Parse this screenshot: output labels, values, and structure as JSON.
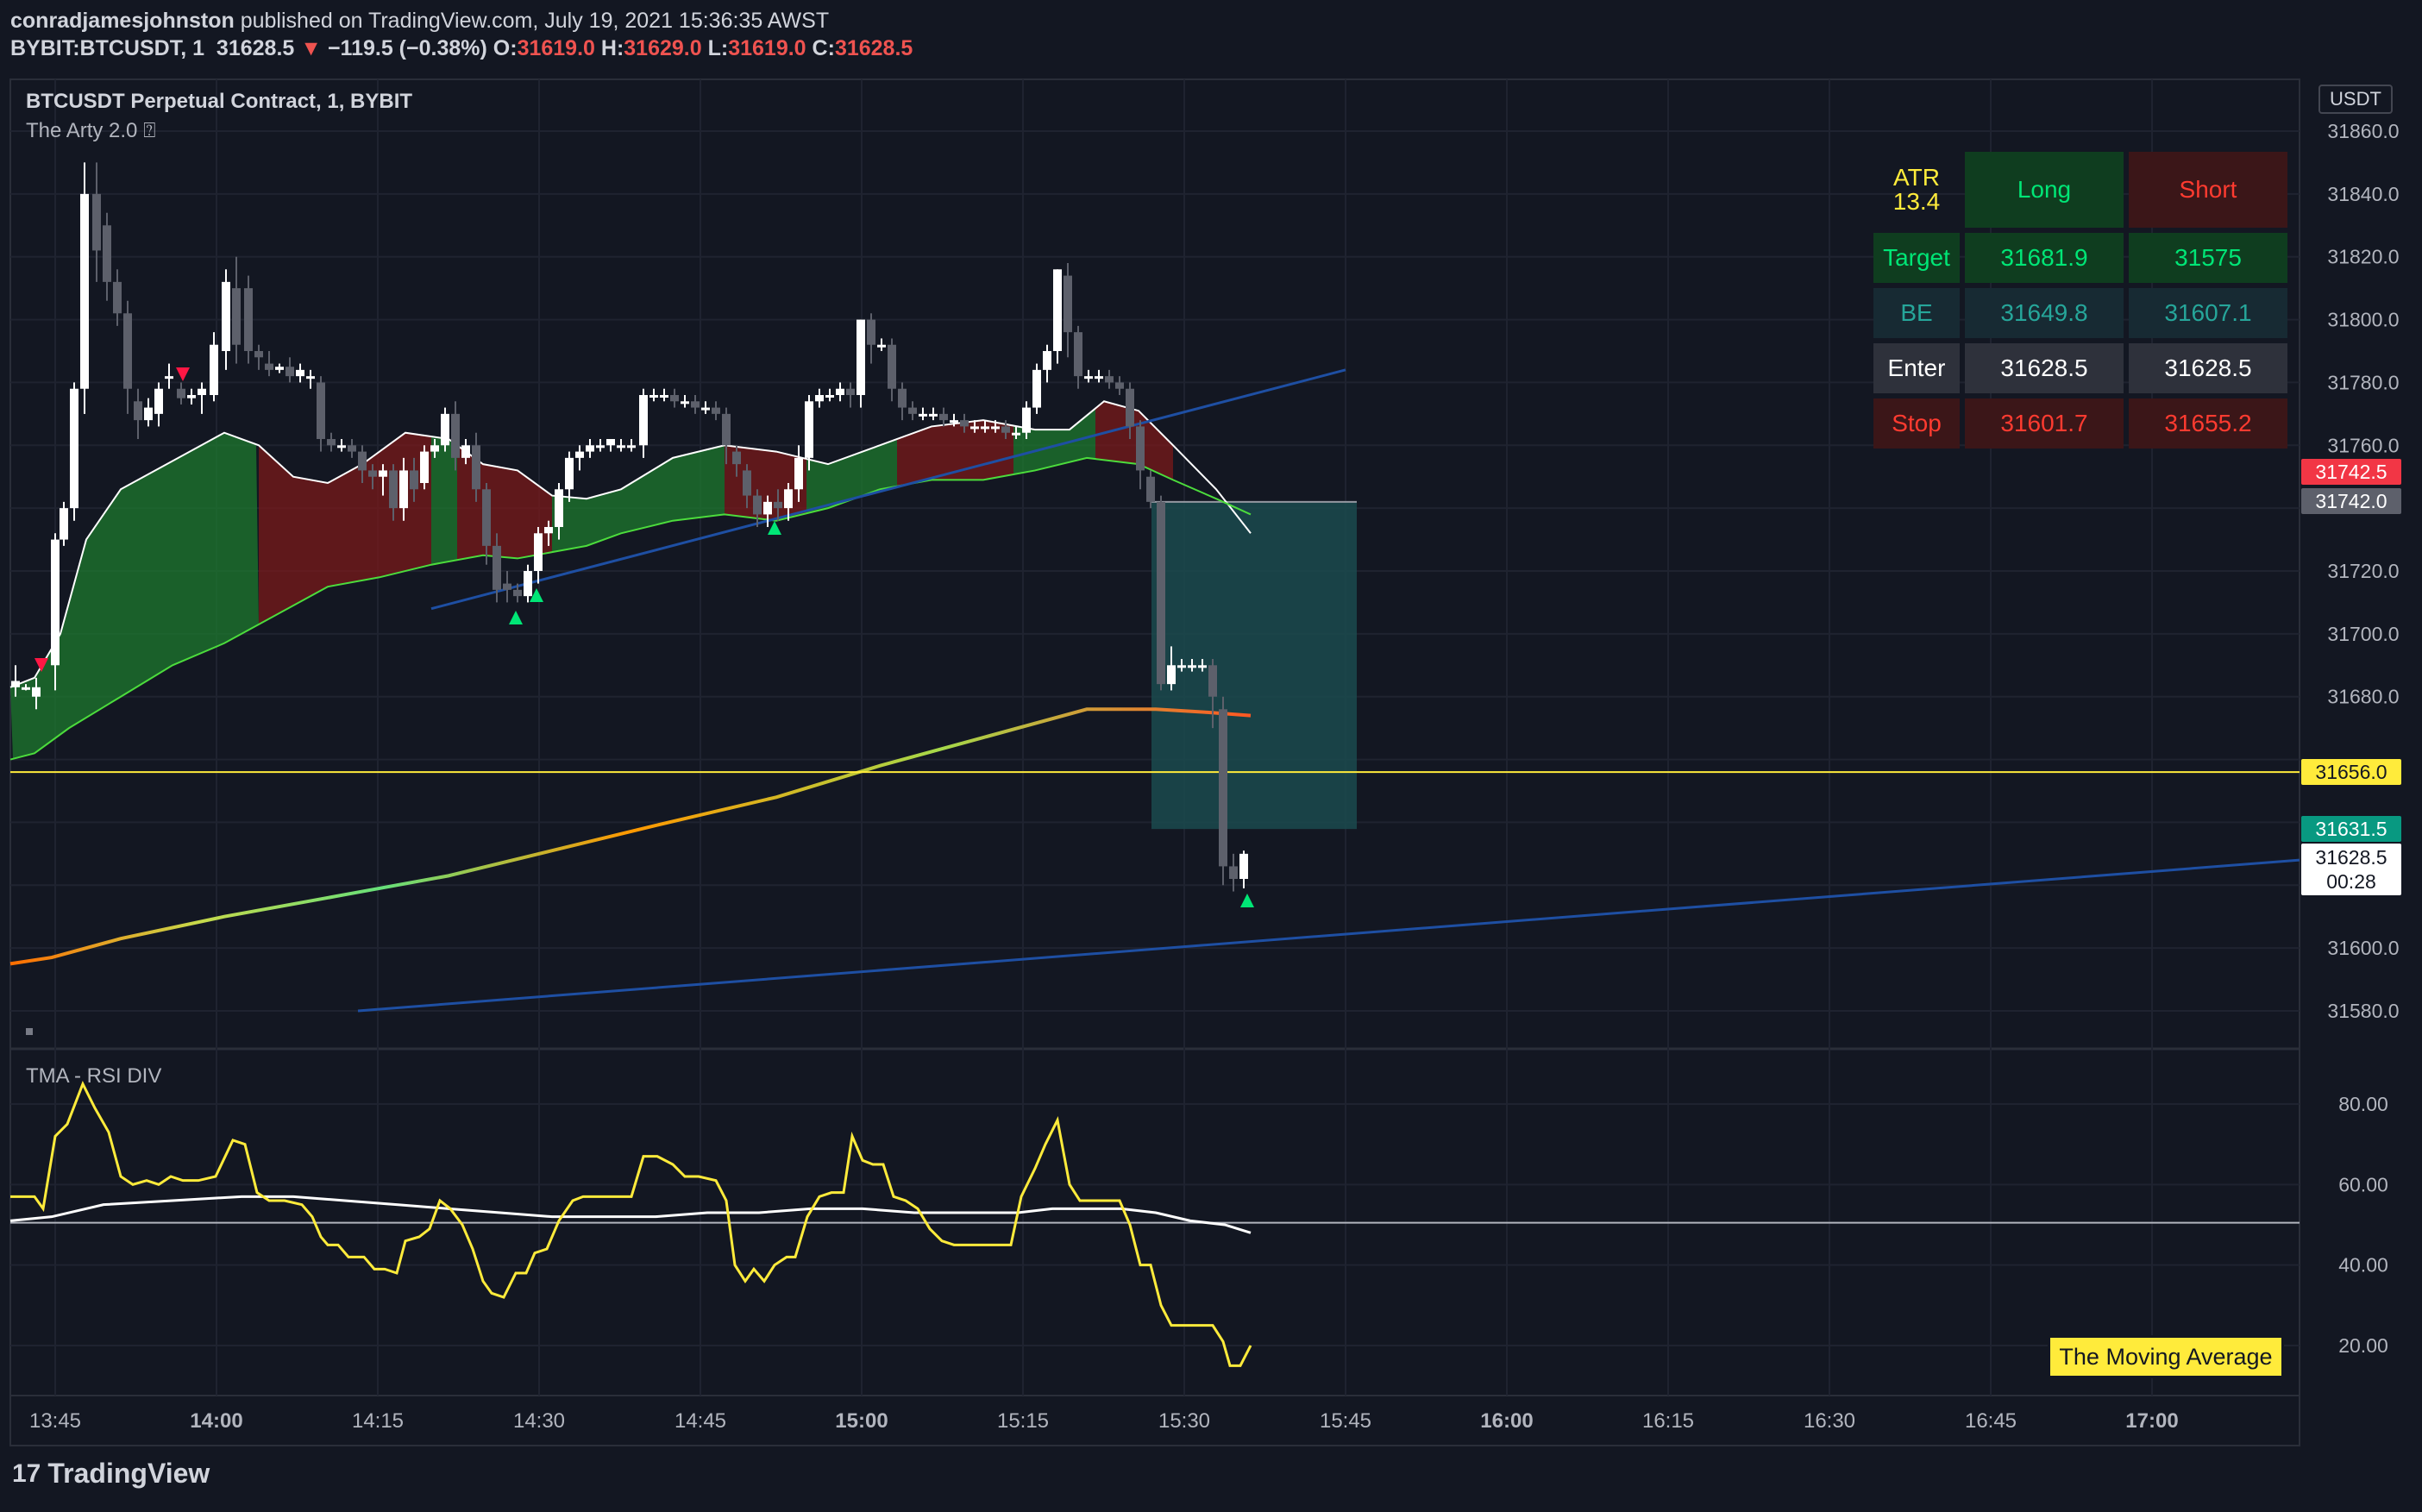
{
  "header": {
    "publisher": "conradjamesjohnston",
    "published_text": "published on TradingView.com, July 19, 2021 15:36:35 AWST",
    "symbol": "BYBIT:BTCUSDT, 1",
    "last": "31628.5",
    "down_arrow": "▼",
    "change": "−119.5 (−0.38%)",
    "o_label": "O:",
    "o_val": "31619.0",
    "h_label": "H:",
    "h_val": "31629.0",
    "l_label": "L:",
    "l_val": "31619.0",
    "c_label": "C:",
    "c_val": "31628.5"
  },
  "legend": {
    "title": "BTCUSDT Perpetual Contract, 1, BYBIT",
    "indicator": "The Arty 2.0 ⍰"
  },
  "oscillator": {
    "title": "TMA - RSI DIV"
  },
  "currency_button": "USDT",
  "info_table": {
    "atr_label": "ATR",
    "atr_value": "13.4",
    "long_header": "Long",
    "short_header": "Short",
    "rows": [
      {
        "label": "Target",
        "long": "31681.9",
        "short": "31575"
      },
      {
        "label": "BE",
        "long": "31649.8",
        "short": "31607.1"
      },
      {
        "label": "Enter",
        "long": "31628.5",
        "short": "31628.5"
      },
      {
        "label": "Stop",
        "long": "31601.7",
        "short": "31655.2"
      }
    ]
  },
  "price_axis": {
    "labels": [
      "31860.0",
      "31840.0",
      "31820.0",
      "31800.0",
      "31780.0",
      "31760.0",
      "31720.0",
      "31700.0",
      "31680.0",
      "31600.0",
      "31580.0"
    ],
    "osc_labels": [
      "80.00",
      "60.00",
      "40.00",
      "20.00"
    ]
  },
  "price_tags": {
    "tag1": "31742.5",
    "tag2": "31742.0",
    "tag3": "31656.0",
    "tag4": "31631.5",
    "current_price": "31628.5",
    "countdown": "00:28"
  },
  "time_axis": {
    "labels": [
      "13:45",
      "14:00",
      "14:15",
      "14:30",
      "14:45",
      "15:00",
      "15:15",
      "15:30",
      "15:45",
      "16:00",
      "16:15",
      "16:30",
      "16:45",
      "17:00"
    ]
  },
  "overlay_label": "The Moving Average",
  "branding": {
    "logo_mark": "17",
    "logo_text": "TradingView"
  },
  "colors": {
    "background": "#131722",
    "bull": "#ffffff",
    "bear": "#5d606b",
    "up_signal": "#00e676",
    "down_signal": "#ff1744",
    "trend_line": "#1e4fa3",
    "level_line": "#ffeb3b",
    "rsi": "#ffeb3b",
    "position_box": "#1b4a4e"
  }
}
